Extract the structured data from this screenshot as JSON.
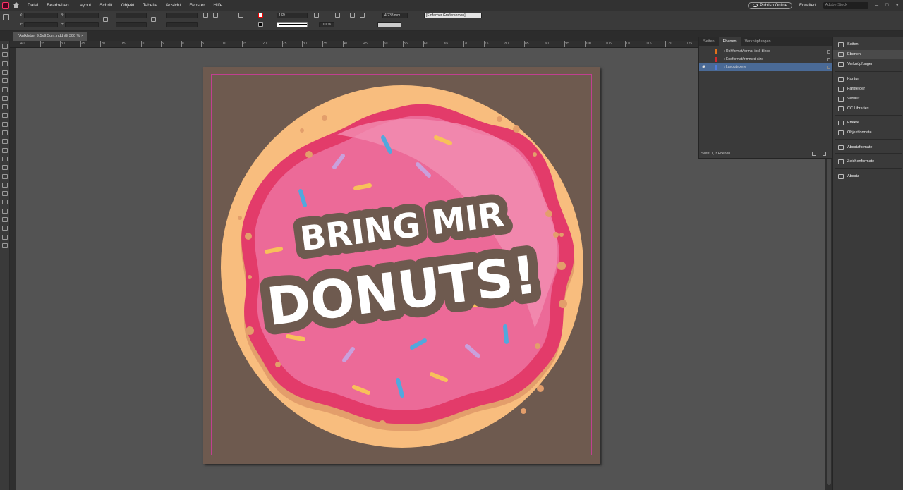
{
  "menubar": {
    "items": [
      "Datei",
      "Bearbeiten",
      "Layout",
      "Schrift",
      "Objekt",
      "Tabelle",
      "Ansicht",
      "Fenster",
      "Hilfe"
    ],
    "publish_label": "Publish Online",
    "workspace_label": "Erweitert",
    "search_placeholder": "Adobe Stock"
  },
  "control": {
    "stroke_weight": "1 Pt",
    "dimension_value": "4,233 mm",
    "object_style": "[Einfacher Grafikrahmen]",
    "opacity": "100 %",
    "label_x": "X:",
    "label_y": "Y:",
    "label_w": "B:",
    "label_h": "H:"
  },
  "document": {
    "tab_label": "*Aufkleber 9,5x9,5cm.indd @ 300 %"
  },
  "ruler": {
    "labels": [
      "40",
      "35",
      "30",
      "25",
      "20",
      "15",
      "10",
      "5",
      "0",
      "5",
      "10",
      "15",
      "20",
      "25",
      "30",
      "35",
      "40",
      "45",
      "50",
      "55",
      "60",
      "65",
      "70",
      "75",
      "80",
      "85",
      "90",
      "95",
      "100",
      "105",
      "110",
      "115",
      "120",
      "125",
      "130",
      "135"
    ]
  },
  "artwork": {
    "line1": "BRING MIR",
    "line2": "DONUTS!"
  },
  "layers_panel": {
    "tabs": [
      "Seiten",
      "Ebenen",
      "Verknüpfungen"
    ],
    "active_tab": "Ebenen",
    "layers": [
      {
        "name": "Rohformat/format incl. bleed",
        "color": "#e0731c"
      },
      {
        "name": "Endformat/trimmed size",
        "color": "#d4282d"
      },
      {
        "name": "Layoutebene",
        "color": "#4f7ad8"
      }
    ],
    "footer": "Seite: 1, 3 Ebenen"
  },
  "dock": {
    "items": [
      "Seiten",
      "Ebenen",
      "Verknüpfungen",
      "Kontur",
      "Farbfelder",
      "Verlauf",
      "CC Libraries",
      "Effekte",
      "Objektformate",
      "Absatzformate",
      "Zeichenformate",
      "Absatz"
    ]
  },
  "colors": {
    "artboard": "#6e5a4f",
    "dough": "#f8bd7e",
    "icing_border": "#e33b6a",
    "icing": "#ec6a98",
    "text_shadow": "#6e5a4f",
    "text_fill": "#ffffff"
  }
}
